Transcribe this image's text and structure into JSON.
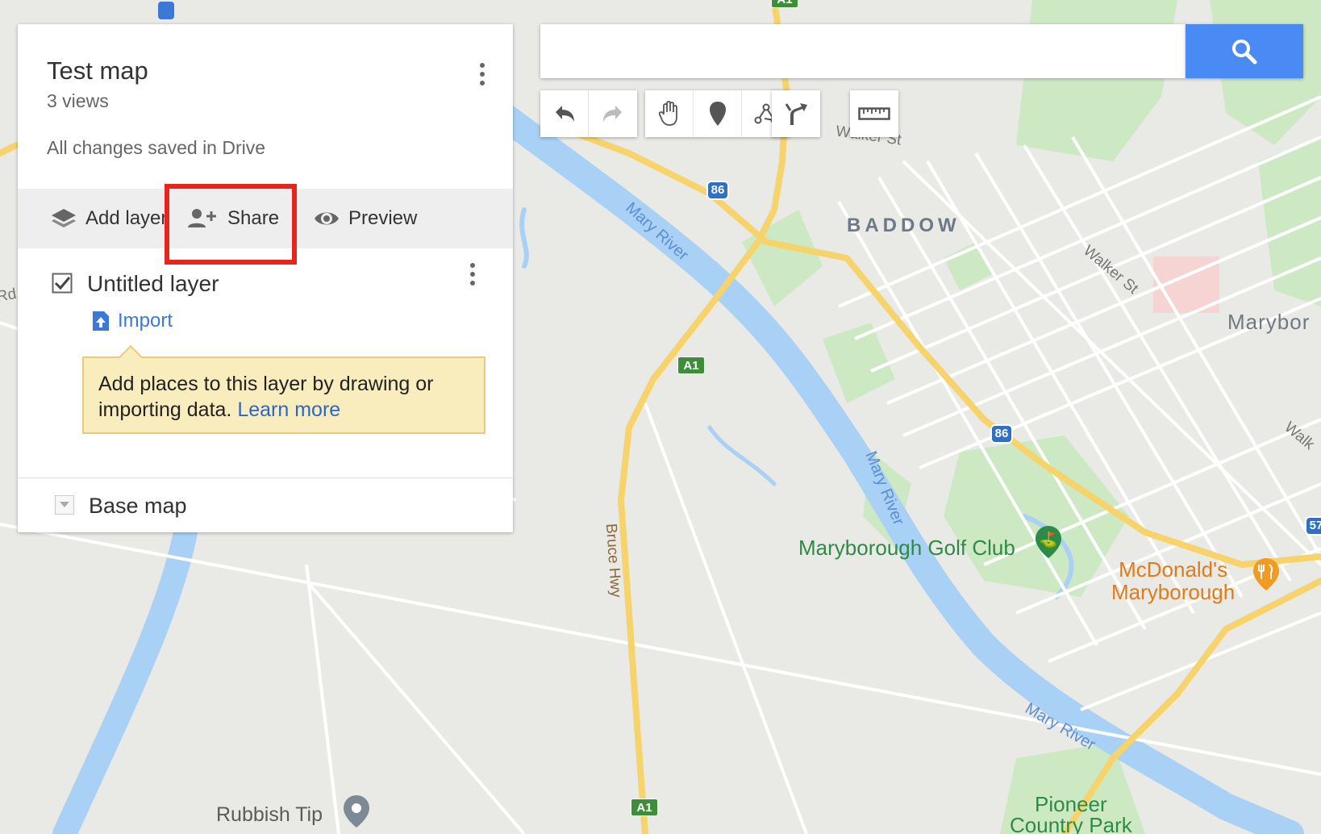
{
  "panel": {
    "title": "Test map",
    "views": "3 views",
    "save_status": "All changes saved in Drive",
    "actions": {
      "add_layer": "Add layer",
      "share": "Share",
      "preview": "Preview"
    },
    "layer": {
      "name": "Untitled layer",
      "checked": true,
      "import_label": "Import",
      "tip_text": "Add places to this layer by drawing or importing data.",
      "tip_link": "Learn more"
    },
    "base_map_label": "Base map"
  },
  "search": {
    "value": "",
    "placeholder": ""
  },
  "drawing_tools": [
    {
      "name": "undo-icon"
    },
    {
      "name": "redo-icon"
    },
    {
      "name": "hand-icon"
    },
    {
      "name": "marker-icon"
    },
    {
      "name": "draw-line-icon"
    },
    {
      "name": "directions-icon"
    },
    {
      "name": "ruler-icon"
    }
  ],
  "map": {
    "labels": {
      "baddow": "BADDOW",
      "maryborough_partial": "Marybor",
      "mary_river": "Mary River",
      "walker_st": "Walker St",
      "walker_st_partial": "Walker St",
      "walk_partial": "Walk",
      "bruce_hwy": "Bruce Hwy",
      "rd_partial": "Rd",
      "golf_club": "Maryborough Golf Club",
      "mcdonalds_line1": "McDonald's",
      "mcdonalds_line2": "Maryborough",
      "rubbish_tip": "Rubbish Tip",
      "pioneer_line1": "Pioneer",
      "pioneer_line2": "Country Park"
    },
    "shields": {
      "a1": "A1",
      "route86": "86",
      "route57": "57"
    },
    "highlight_color": "#e8241b",
    "accent_color": "#4a8af4"
  }
}
